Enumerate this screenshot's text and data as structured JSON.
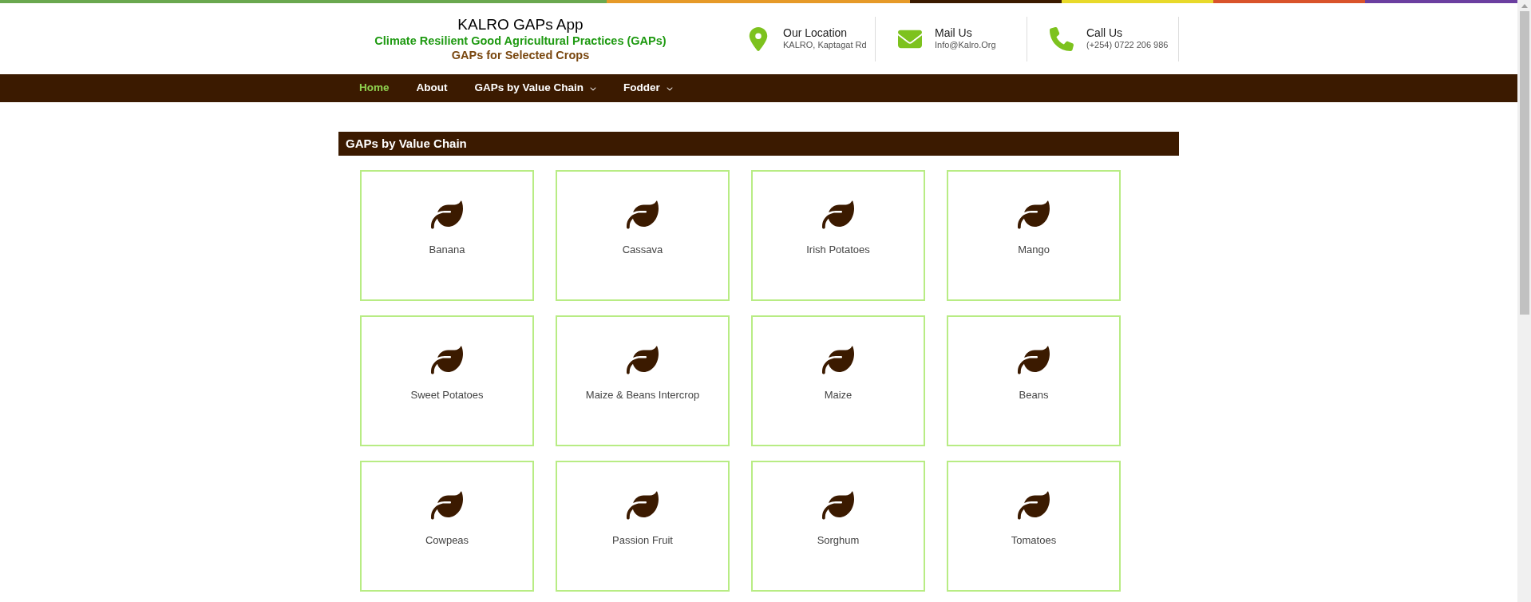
{
  "header": {
    "title": "KALRO GAPs App",
    "subtitle": "Climate Resilient Good Agricultural Practices (GAPs)",
    "tagline": "GAPs for Selected Crops"
  },
  "contacts": [
    {
      "kind": "location",
      "label": "Our Location",
      "detail": "KALRO, Kaptagat Rd"
    },
    {
      "kind": "mail",
      "label": "Mail Us",
      "detail": "Info@Kalro.Org"
    },
    {
      "kind": "phone",
      "label": "Call Us",
      "detail": "(+254) 0722 206 986"
    }
  ],
  "nav": [
    {
      "label": "Home",
      "selected": true,
      "has_menu": false
    },
    {
      "label": "About",
      "selected": false,
      "has_menu": false
    },
    {
      "label": "GAPs by Value Chain",
      "selected": false,
      "has_menu": true
    },
    {
      "label": "Fodder",
      "selected": false,
      "has_menu": true
    }
  ],
  "section": {
    "title": "GAPs by Value Chain"
  },
  "crops": [
    "Banana",
    "Cassava",
    "Irish Potatoes",
    "Mango",
    "Sweet Potatoes",
    "Maize & Beans Intercrop",
    "Maize",
    "Beans",
    "Cowpeas",
    "Passion Fruit",
    "Sorghum",
    "Tomatoes"
  ]
}
